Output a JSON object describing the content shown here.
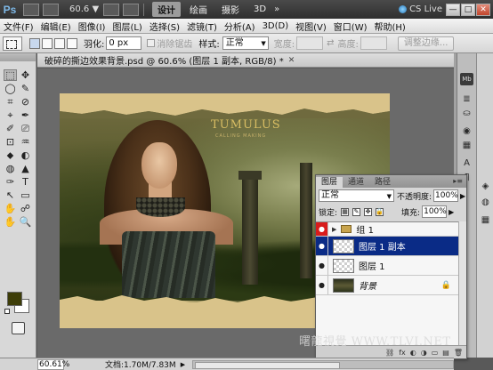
{
  "appbar": {
    "logo": "Ps",
    "zoom": "60.6",
    "zoom_arrow": "▼",
    "workspaces": [
      "设计",
      "绘画",
      "摄影",
      "3D"
    ],
    "more_workspaces": "»",
    "cs_live": "CS Live",
    "window_buttons": [
      "—",
      "□",
      "✕"
    ]
  },
  "menubar": {
    "items": [
      "文件(F)",
      "编辑(E)",
      "图像(I)",
      "图层(L)",
      "选择(S)",
      "滤镜(T)",
      "分析(A)",
      "3D(D)",
      "视图(V)",
      "窗口(W)",
      "帮助(H)"
    ]
  },
  "optbar": {
    "feather_label": "羽化:",
    "feather_value": "0 px",
    "antialias_label": "消除锯齿",
    "style_label": "样式:",
    "style_value": "正常",
    "width_label": "宽度:",
    "height_label": "高度:",
    "swap_icon": "⇄",
    "refine_label": "调整边缘..."
  },
  "tools": {
    "icons": [
      "⬚",
      "✥",
      "◯",
      "✎",
      "⌗",
      "⊘",
      "⌖",
      "✒",
      "✐",
      "⎚",
      "⊡",
      "♒",
      "⬥",
      "◐",
      "◍",
      "▲",
      "✑",
      "T",
      "↖",
      "▭",
      "✋",
      "☍",
      "✋",
      "🔍"
    ]
  },
  "document": {
    "tab_title": "破碎的撕边效果背景.psd @ 60.6% (图层 1 副本, RGB/8) *",
    "close_glyph": "✕",
    "image_title": "TUMULUS",
    "image_subtitle": "CALLING MAKING"
  },
  "dock": {
    "buttons": [
      "Mb",
      "≣",
      "⛀",
      "◉",
      "▦",
      "A",
      "¶"
    ],
    "layer_buttons": [
      "◈",
      "◍",
      "▦"
    ]
  },
  "layers_panel": {
    "tabs": [
      "图层",
      "通道",
      "路径"
    ],
    "menu_glyph": "▸≡",
    "blend_mode": "正常",
    "opacity_label": "不透明度:",
    "opacity_value": "100%",
    "lock_label": "锁定:",
    "lock_icons": [
      "▦",
      "✎",
      "✥",
      "🔒"
    ],
    "fill_label": "填充:",
    "fill_value": "100%",
    "arrow": "▶",
    "eye_glyph": "●",
    "group_triangle": "▶",
    "layers": [
      {
        "name": "组 1",
        "type": "group"
      },
      {
        "name": "图层 1 副本",
        "type": "layer",
        "selected": true
      },
      {
        "name": "图层 1",
        "type": "layer"
      },
      {
        "name": "背景",
        "type": "background",
        "locked": true,
        "lock_glyph": "🔒"
      }
    ],
    "footer_icons": [
      "⛓",
      "fx",
      "◐",
      "◑",
      "▭",
      "▤",
      "🗑"
    ]
  },
  "statusbar": {
    "zoom": "60.61%",
    "doc_info": "文档:1.70M/7.83M",
    "arrow": "▶"
  },
  "watermark": "曙龍視覺 WWW.TLVI.NET",
  "colors": {
    "foreground": "#3d3d08",
    "background": "#ffffff",
    "selected_layer": "#0a2b86",
    "eye_highlight": "#d81c1c"
  }
}
